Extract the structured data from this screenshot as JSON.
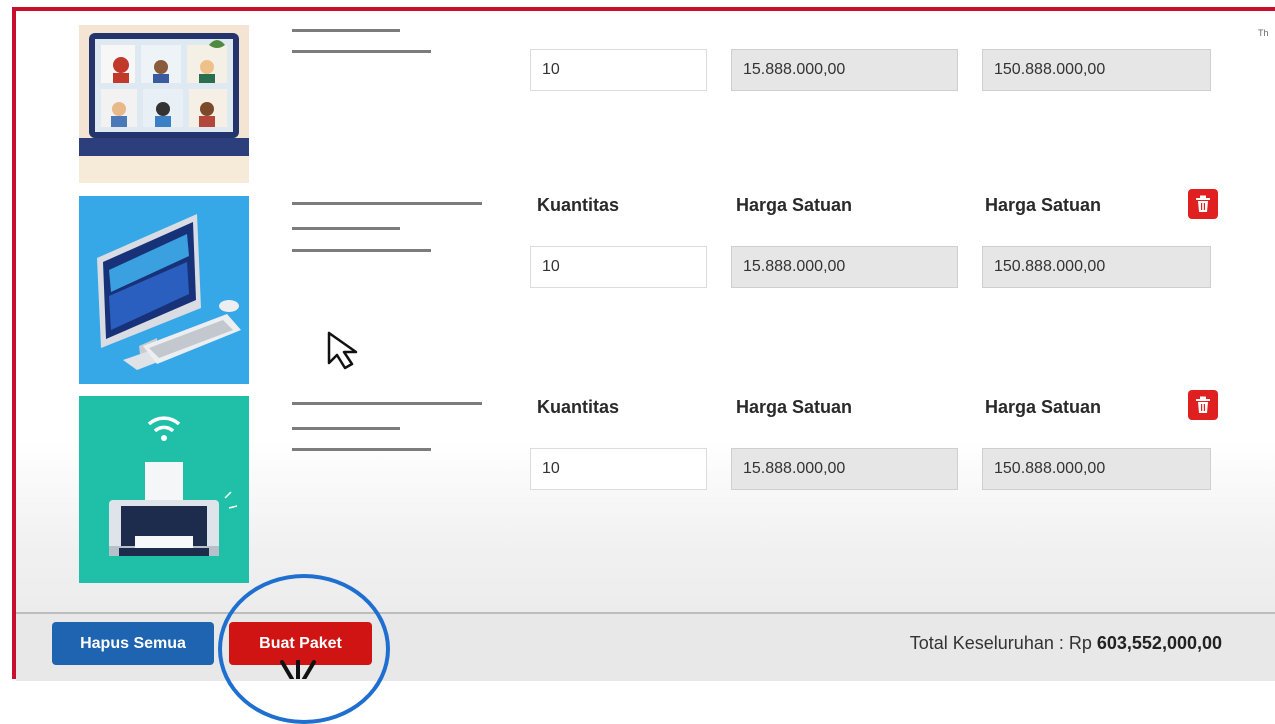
{
  "top_right_text": "Th",
  "items": [
    {
      "image_icon": "video-conference-laptop-image",
      "quantity_value": "10",
      "unit_price_value": "15.888.000,00",
      "subtotal_value": "150.888.000,00"
    },
    {
      "image_icon": "desktop-computer-image",
      "qty_label": "Kuantitas",
      "unit_price_label": "Harga Satuan",
      "subtotal_label": "Harga Satuan",
      "quantity_value": "10",
      "unit_price_value": "15.888.000,00",
      "subtotal_value": "150.888.000,00",
      "delete_icon": "trash-icon"
    },
    {
      "image_icon": "wireless-printer-image",
      "qty_label": "Kuantitas",
      "unit_price_label": "Harga Satuan",
      "subtotal_label": "Harga Satuan",
      "quantity_value": "10",
      "unit_price_value": "15.888.000,00",
      "subtotal_value": "150.888.000,00",
      "delete_icon": "trash-icon"
    }
  ],
  "footer": {
    "clear_all_label": "Hapus Semua",
    "create_package_label": "Buat Paket",
    "total_label": "Total Keseluruhan : Rp ",
    "total_value": "603,552,000,00"
  },
  "colors": {
    "frame_border": "#c8102e",
    "clear_all_button": "#1f64b0",
    "create_package_button": "#d01414",
    "delete_button": "#e02020",
    "annotation": "#1f6fd0"
  }
}
